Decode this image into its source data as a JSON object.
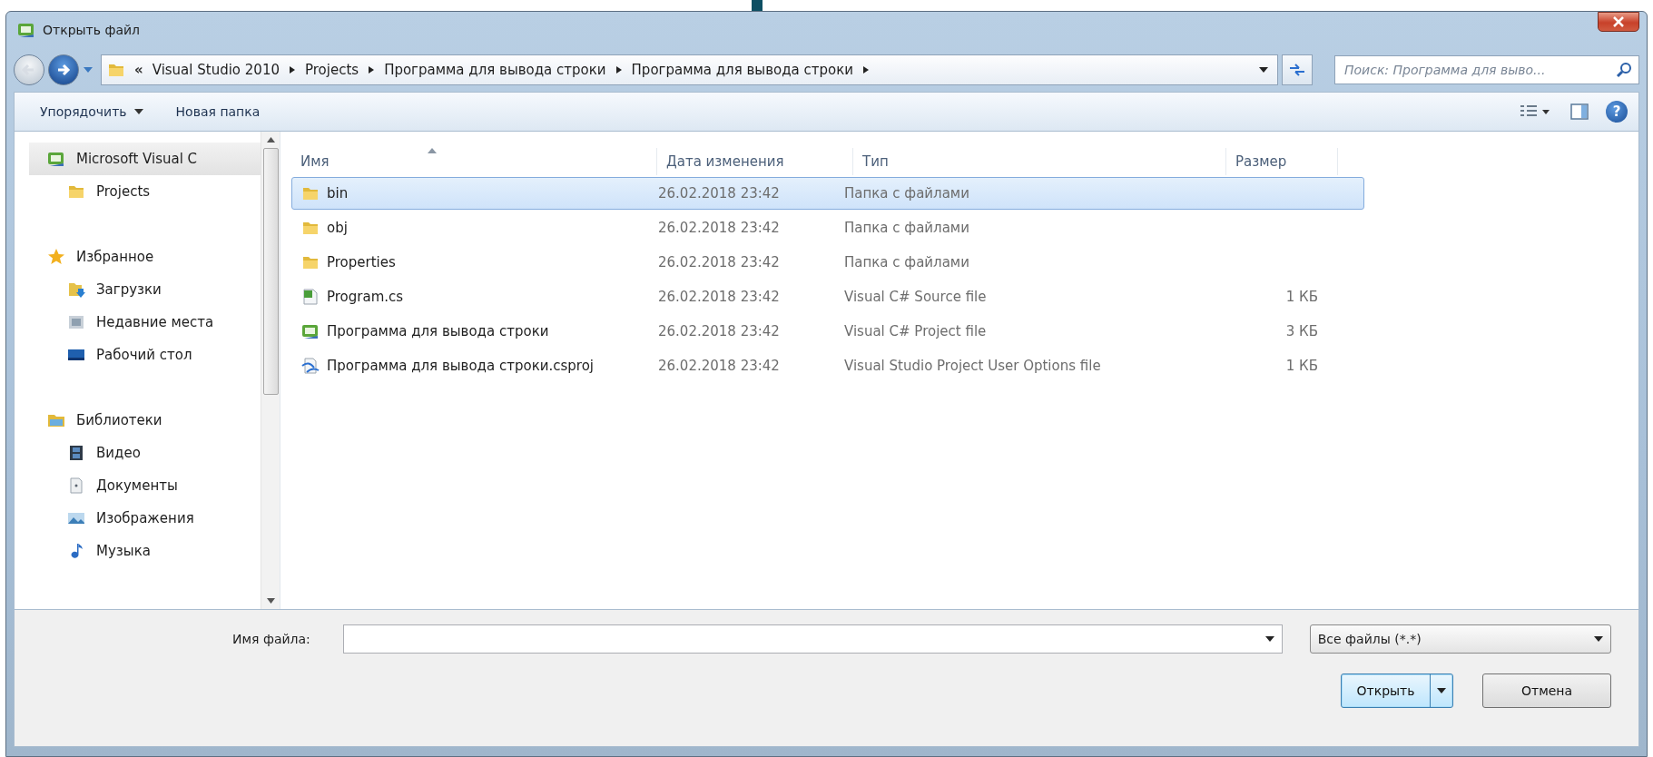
{
  "window": {
    "title": "Открыть файл"
  },
  "address": {
    "prefix": "«",
    "segments": [
      "Visual Studio 2010",
      "Projects",
      "Программа для вывода строки",
      "Программа для вывода строки"
    ]
  },
  "search": {
    "placeholder": "Поиск: Программа для выво..."
  },
  "toolbar": {
    "buttons": [
      {
        "label": "Упорядочить",
        "dropdown": true
      },
      {
        "label": "Новая папка",
        "dropdown": false
      }
    ],
    "help": "?"
  },
  "sidebar": {
    "groups": [
      {
        "label": "Microsoft Visual C",
        "kind": "app",
        "selected": true,
        "children": [
          {
            "label": "Projects",
            "kind": "folder",
            "selected": false
          }
        ]
      },
      {
        "label": "Избранное",
        "kind": "star",
        "selected": false,
        "children": [
          {
            "label": "Загрузки",
            "kind": "downloads",
            "selected": false
          },
          {
            "label": "Недавние места",
            "kind": "recent",
            "selected": false
          },
          {
            "label": "Рабочий стол",
            "kind": "desktop",
            "selected": false
          }
        ]
      },
      {
        "label": "Библиотеки",
        "kind": "library",
        "selected": false,
        "children": [
          {
            "label": "Видео",
            "kind": "video",
            "selected": false
          },
          {
            "label": "Документы",
            "kind": "documents",
            "selected": false
          },
          {
            "label": "Изображения",
            "kind": "pictures",
            "selected": false
          },
          {
            "label": "Музыка",
            "kind": "music",
            "selected": false
          }
        ]
      }
    ]
  },
  "files": {
    "columns": [
      "Имя",
      "Дата изменения",
      "Тип",
      "Размер"
    ],
    "rows": [
      {
        "name": "bin",
        "date": "26.02.2018 23:42",
        "type": "Папка с файлами",
        "kind": "folder",
        "selected": true
      },
      {
        "name": "obj",
        "date": "26.02.2018 23:42",
        "type": "Папка с файлами",
        "kind": "folder",
        "selected": false
      },
      {
        "name": "Properties",
        "date": "26.02.2018 23:42",
        "type": "Папка с файлами",
        "kind": "folder",
        "selected": false
      },
      {
        "name": "Program.cs",
        "date": "26.02.2018 23:42",
        "type": "Visual C# Source file",
        "size": "1 КБ",
        "kind": "code",
        "selected": false
      },
      {
        "name": "Программа для вывода строки",
        "date": "26.02.2018 23:42",
        "type": "Visual C# Project file",
        "size": "3 КБ",
        "kind": "app",
        "selected": false
      },
      {
        "name": "Программа для вывода строки.csproj",
        "date": "26.02.2018 23:42",
        "type": "Visual Studio Project User Options file",
        "size": "1 КБ",
        "kind": "user",
        "selected": false
      }
    ]
  },
  "filename": {
    "label": "Имя файла:"
  },
  "filter": {
    "value": "Все файлы (*.*)"
  },
  "buttons": {
    "open": "Открыть",
    "cancel": "Отмена"
  }
}
